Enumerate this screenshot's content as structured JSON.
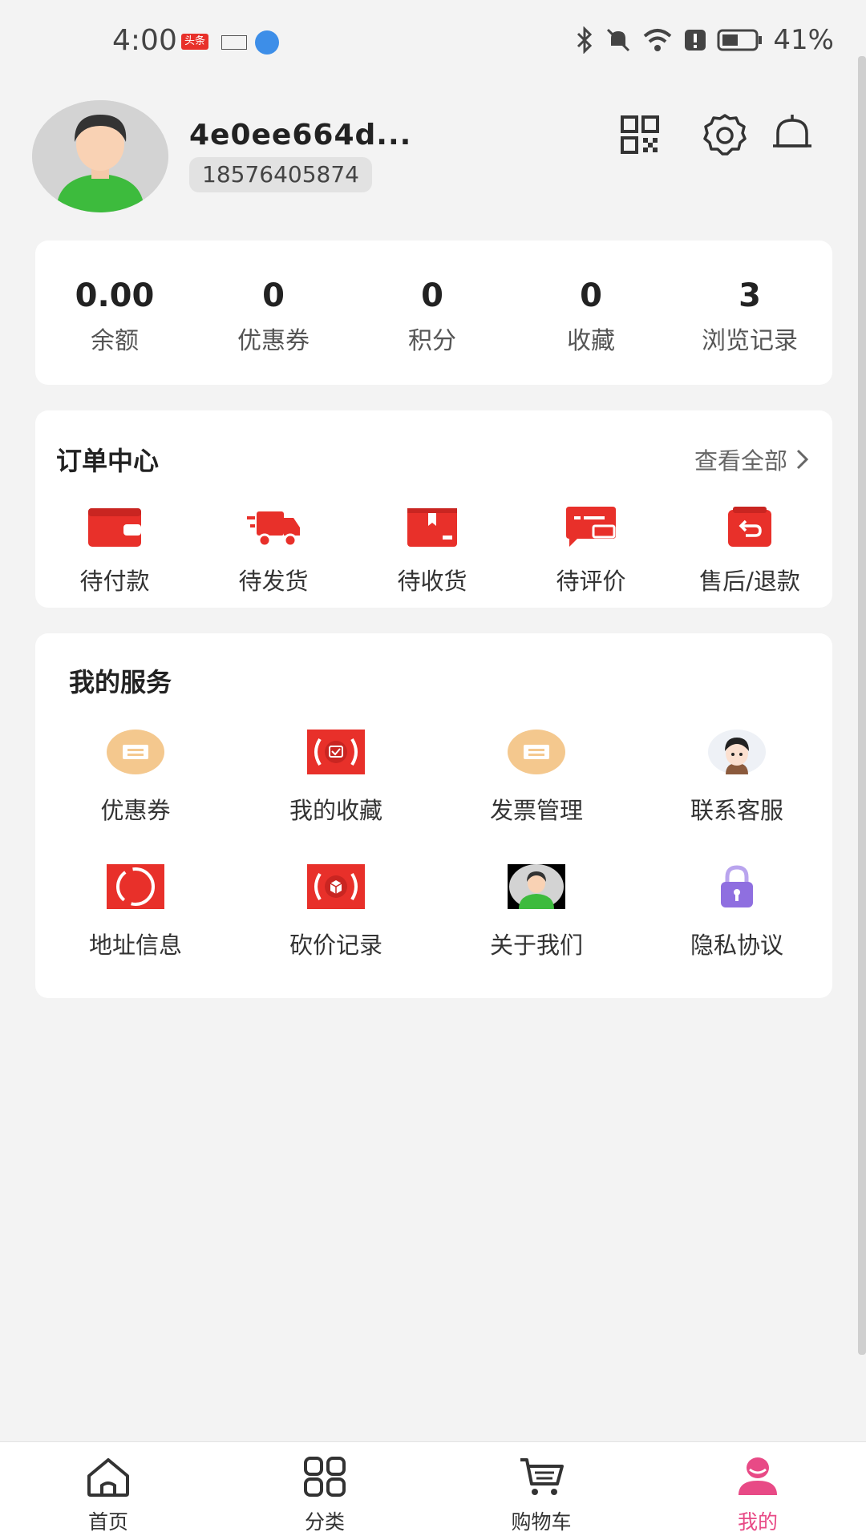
{
  "status_bar": {
    "time": "4:00",
    "badge_news": "头条",
    "battery": "41%"
  },
  "profile": {
    "username": "4e0ee664d...",
    "phone": "18576405874"
  },
  "stats": [
    {
      "value": "0.00",
      "label": "余额"
    },
    {
      "value": "0",
      "label": "优惠券"
    },
    {
      "value": "0",
      "label": "积分"
    },
    {
      "value": "0",
      "label": "收藏"
    },
    {
      "value": "3",
      "label": "浏览记录"
    }
  ],
  "orders": {
    "title": "订单中心",
    "view_all": "查看全部",
    "items": [
      {
        "label": "待付款",
        "icon": "wallet-icon"
      },
      {
        "label": "待发货",
        "icon": "delivery-truck-icon"
      },
      {
        "label": "待收货",
        "icon": "package-icon"
      },
      {
        "label": "待评价",
        "icon": "review-chat-icon"
      },
      {
        "label": "售后/退款",
        "icon": "refund-bag-icon"
      }
    ]
  },
  "services": {
    "title": "我的服务",
    "items": [
      {
        "label": "优惠券",
        "icon": "coupon-icon"
      },
      {
        "label": "我的收藏",
        "icon": "favorites-icon"
      },
      {
        "label": "发票管理",
        "icon": "invoice-icon"
      },
      {
        "label": "联系客服",
        "icon": "customer-service-avatar-icon"
      },
      {
        "label": "地址信息",
        "icon": "address-icon"
      },
      {
        "label": "砍价记录",
        "icon": "bargain-icon"
      },
      {
        "label": "关于我们",
        "icon": "about-us-avatar-icon"
      },
      {
        "label": "隐私协议",
        "icon": "privacy-lock-icon"
      }
    ]
  },
  "tabs": [
    {
      "label": "首页",
      "icon": "home-icon"
    },
    {
      "label": "分类",
      "icon": "category-grid-icon"
    },
    {
      "label": "购物车",
      "icon": "cart-icon"
    },
    {
      "label": "我的",
      "icon": "profile-icon"
    }
  ],
  "colors": {
    "accent_red": "#e8302a",
    "active_pink": "#e84a86",
    "background": "#f3f3f3"
  }
}
